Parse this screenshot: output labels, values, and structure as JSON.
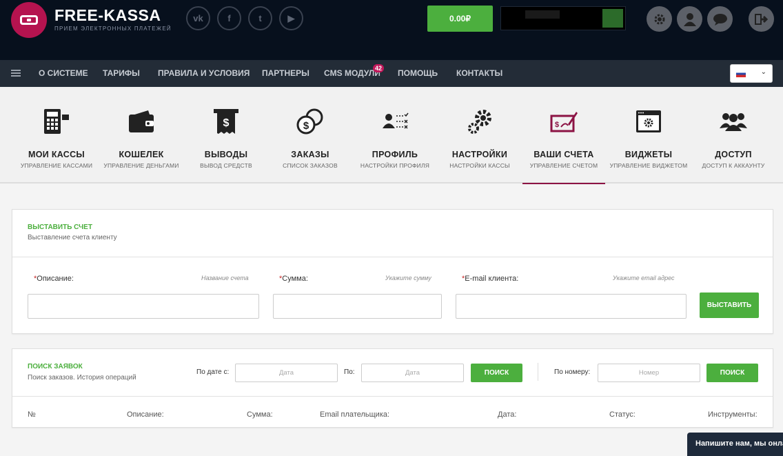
{
  "brand": {
    "name": "FREE-KASSA",
    "tagline": "ПРИЕМ ЭЛЕКТРОННЫХ ПЛАТЕЖЕЙ"
  },
  "social": [
    {
      "icon": "vk-icon",
      "glyph": "vk"
    },
    {
      "icon": "facebook-icon",
      "glyph": "f"
    },
    {
      "icon": "twitter-icon",
      "glyph": "t"
    },
    {
      "icon": "youtube-icon",
      "glyph": "▶"
    }
  ],
  "header": {
    "balance": "0.00₽"
  },
  "nav": [
    "О СИСТЕМЕ",
    "ТАРИФЫ",
    "ПРАВИЛА И УСЛОВИЯ",
    "ПАРТНЕРЫ",
    "CMS МОДУЛИ",
    "ПОМОЩЬ",
    "КОНТАКТЫ"
  ],
  "cms_badge": "42",
  "tiles": [
    {
      "title": "МОИ КАССЫ",
      "sub": "УПРАВЛЕНИЕ КАССАМИ",
      "icon": "calculator-icon"
    },
    {
      "title": "КОШЕЛЕК",
      "sub": "УПРАВЛЕНИЕ ДЕНЬГАМИ",
      "icon": "wallet-icon"
    },
    {
      "title": "ВЫВОДЫ",
      "sub": "ВЫВОД СРЕДСТВ",
      "icon": "receipt-icon"
    },
    {
      "title": "ЗАКАЗЫ",
      "sub": "СПИСОК ЗАКАЗОВ",
      "icon": "coins-icon"
    },
    {
      "title": "ПРОФИЛЬ",
      "sub": "НАСТРОЙКИ ПРОФИЛЯ",
      "icon": "profile-checklist-icon"
    },
    {
      "title": "НАСТРОЙКИ",
      "sub": "НАСТРОЙКИ КАССЫ",
      "icon": "gears-icon"
    },
    {
      "title": "ВАШИ СЧЕТА",
      "sub": "УПРАВЛЕНИЕ СЧЕТОМ",
      "icon": "invoice-icon"
    },
    {
      "title": "ВИДЖЕТЫ",
      "sub": "УПРАВЛЕНИЕ ВИДЖЕТОМ",
      "icon": "widget-window-icon"
    },
    {
      "title": "ДОСТУП",
      "sub": "ДОСТУП К АККАУНТУ",
      "icon": "users-icon"
    }
  ],
  "invoice": {
    "title": "ВЫСТАВИТЬ СЧЕТ",
    "subtitle": "Выставление счета клиенту",
    "desc_label": "Описание:",
    "desc_hint": "Название счета",
    "sum_label": "Сумма:",
    "sum_hint": "Укажите сумму",
    "email_label": "E-mail клиента:",
    "email_hint": "Укажите email адрес",
    "submit": "ВЫСТАВИТЬ",
    "required_mark": "*"
  },
  "search": {
    "title": "ПОИСК ЗАЯВОК",
    "subtitle": "Поиск заказов. История операций",
    "from_label": "По дате с:",
    "from_placeholder": "Дата",
    "to_label": "По:",
    "to_placeholder": "Дата",
    "search_btn": "ПОИСК",
    "num_label": "По номеру:",
    "num_placeholder": "Номер",
    "search_btn2": "ПОИСК",
    "columns": [
      "№",
      "Описание:",
      "Сумма:",
      "Email плательщика:",
      "Дата:",
      "Статус:",
      "Инструменты:"
    ]
  },
  "chat": "Напишите нам, мы онлайн!"
}
